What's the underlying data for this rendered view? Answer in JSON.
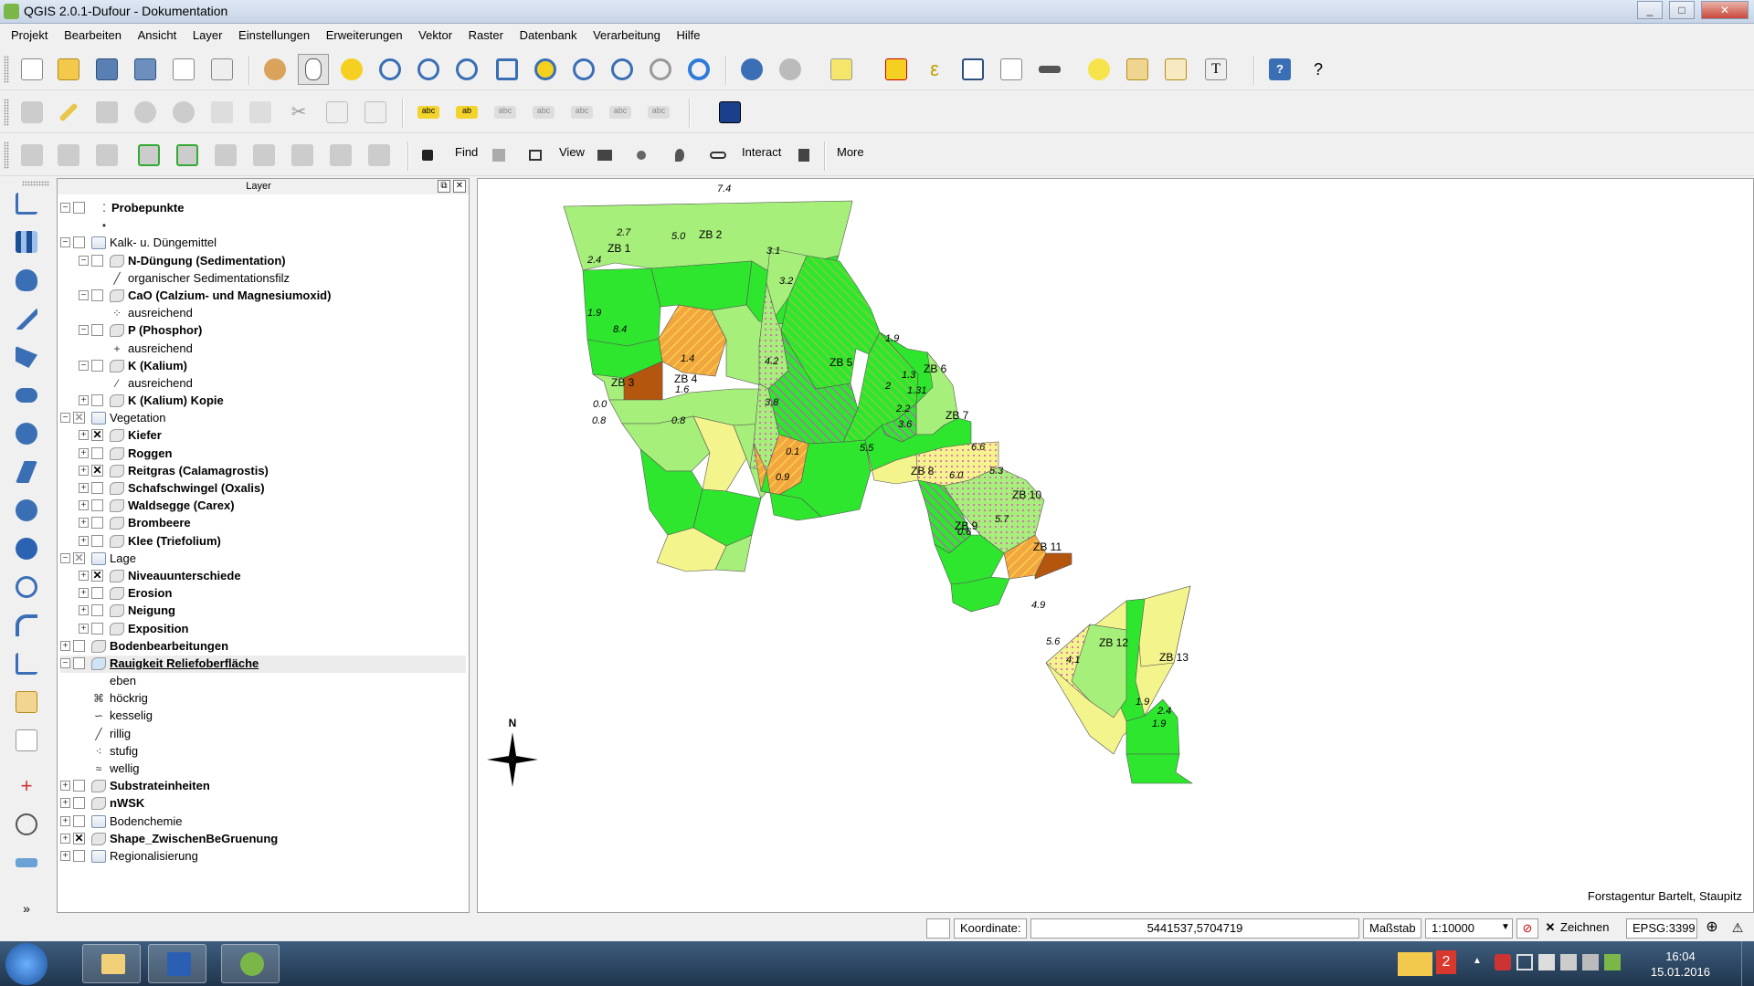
{
  "window": {
    "title": "QGIS 2.0.1-Dufour - Dokumentation",
    "min_label": "_",
    "max_label": "□",
    "close_label": "✕"
  },
  "menu": [
    "Projekt",
    "Bearbeiten",
    "Ansicht",
    "Layer",
    "Einstellungen",
    "Erweiterungen",
    "Vektor",
    "Raster",
    "Datenbank",
    "Verarbeitung",
    "Hilfe"
  ],
  "toolbar3": {
    "find_label": "Find",
    "view_label": "View",
    "interact_label": "Interact",
    "more_label": "More"
  },
  "layers_panel": {
    "title": "Layer",
    "float_label": "⧉",
    "close_label": "✕",
    "rows": [
      {
        "label": "Probepunkte",
        "bold": true
      },
      {
        "label": "",
        "bold": false
      },
      {
        "label": "Kalk- u. Düngemittel",
        "bold": false
      },
      {
        "label": "N-Düngung (Sedimentation)",
        "bold": true
      },
      {
        "label": "organischer Sedimentationsfilz",
        "bold": false
      },
      {
        "label": "CaO (Calzium- und Magnesiumoxid)",
        "bold": true
      },
      {
        "label": "ausreichend",
        "bold": false
      },
      {
        "label": "P (Phosphor)",
        "bold": true
      },
      {
        "label": "ausreichend",
        "bold": false
      },
      {
        "label": "K (Kalium)",
        "bold": true
      },
      {
        "label": "ausreichend",
        "bold": false
      },
      {
        "label": "K (Kalium) Kopie",
        "bold": true
      },
      {
        "label": "Vegetation",
        "bold": false
      },
      {
        "label": "Kiefer",
        "bold": true
      },
      {
        "label": "Roggen",
        "bold": true
      },
      {
        "label": "Reitgras (Calamagrostis)",
        "bold": true
      },
      {
        "label": "Schafschwingel (Oxalis)",
        "bold": true
      },
      {
        "label": "Waldsegge (Carex)",
        "bold": true
      },
      {
        "label": "Brombeere",
        "bold": true
      },
      {
        "label": "Klee (Triefolium)",
        "bold": true
      },
      {
        "label": "Lage",
        "bold": false
      },
      {
        "label": "Niveauunterschiede",
        "bold": true
      },
      {
        "label": "Erosion",
        "bold": true
      },
      {
        "label": "Neigung",
        "bold": true
      },
      {
        "label": "Exposition",
        "bold": true
      },
      {
        "label": "Bodenbearbeitungen",
        "bold": true
      },
      {
        "label": "Rauigkeit Reliefoberfläche",
        "bold": true
      },
      {
        "label": "eben",
        "bold": false
      },
      {
        "label": "höckrig",
        "bold": false
      },
      {
        "label": "kesselig",
        "bold": false
      },
      {
        "label": "rillig",
        "bold": false
      },
      {
        "label": "stufig",
        "bold": false
      },
      {
        "label": "wellig",
        "bold": false
      },
      {
        "label": "Substrateinheiten",
        "bold": true
      },
      {
        "label": "nWSK",
        "bold": true
      },
      {
        "label": "Bodenchemie",
        "bold": false
      },
      {
        "label": "Shape_ZwischenBeGruenung",
        "bold": true
      },
      {
        "label": "Regionalisierung",
        "bold": false
      }
    ]
  },
  "map": {
    "attribution": "Forstagentur Bartelt, Staupitz",
    "north_label": "N",
    "zone_labels": [
      "ZB 1",
      "ZB 2",
      "ZB 3",
      "ZB 4",
      "ZB 5",
      "ZB 6",
      "ZB 7",
      "ZB 8",
      "ZB 9",
      "ZB 10",
      "ZB 11",
      "ZB 12",
      "ZB 13"
    ],
    "value_labels": [
      "7.4",
      "2.7",
      "5.0",
      "2.4",
      "1.9",
      "8.4",
      "1.4",
      "1.6",
      "0.0",
      "0.8",
      "0.8",
      "3.1",
      "3.2",
      "4.2",
      "3.8",
      "0.1",
      "0.9",
      "1.9",
      "2",
      "5.5",
      "1.3",
      "1.31",
      "2.2",
      "3.6",
      "6.6",
      "6.0",
      "5.3",
      "5.7",
      "0.6",
      "4.9",
      "5.6",
      "4.1",
      "1.9",
      "2.4",
      "1.9"
    ],
    "colors": {
      "dark_green": "#2ee62e",
      "light_green": "#a6ef7a",
      "yellow": "#f4f48c",
      "orange": "#f2a640",
      "brown": "#b5560f",
      "magenta": "#e040d8"
    }
  },
  "statusbar": {
    "coord_label": "Koordinate:",
    "coord_value": "5441537,5704719",
    "scale_label": "Maßstab",
    "scale_value": "1:10000",
    "render_label": "Zeichnen",
    "epsg": "EPSG:3399"
  },
  "taskbar": {
    "time": "16:04",
    "date": "15.01.2016",
    "badge": "2"
  }
}
